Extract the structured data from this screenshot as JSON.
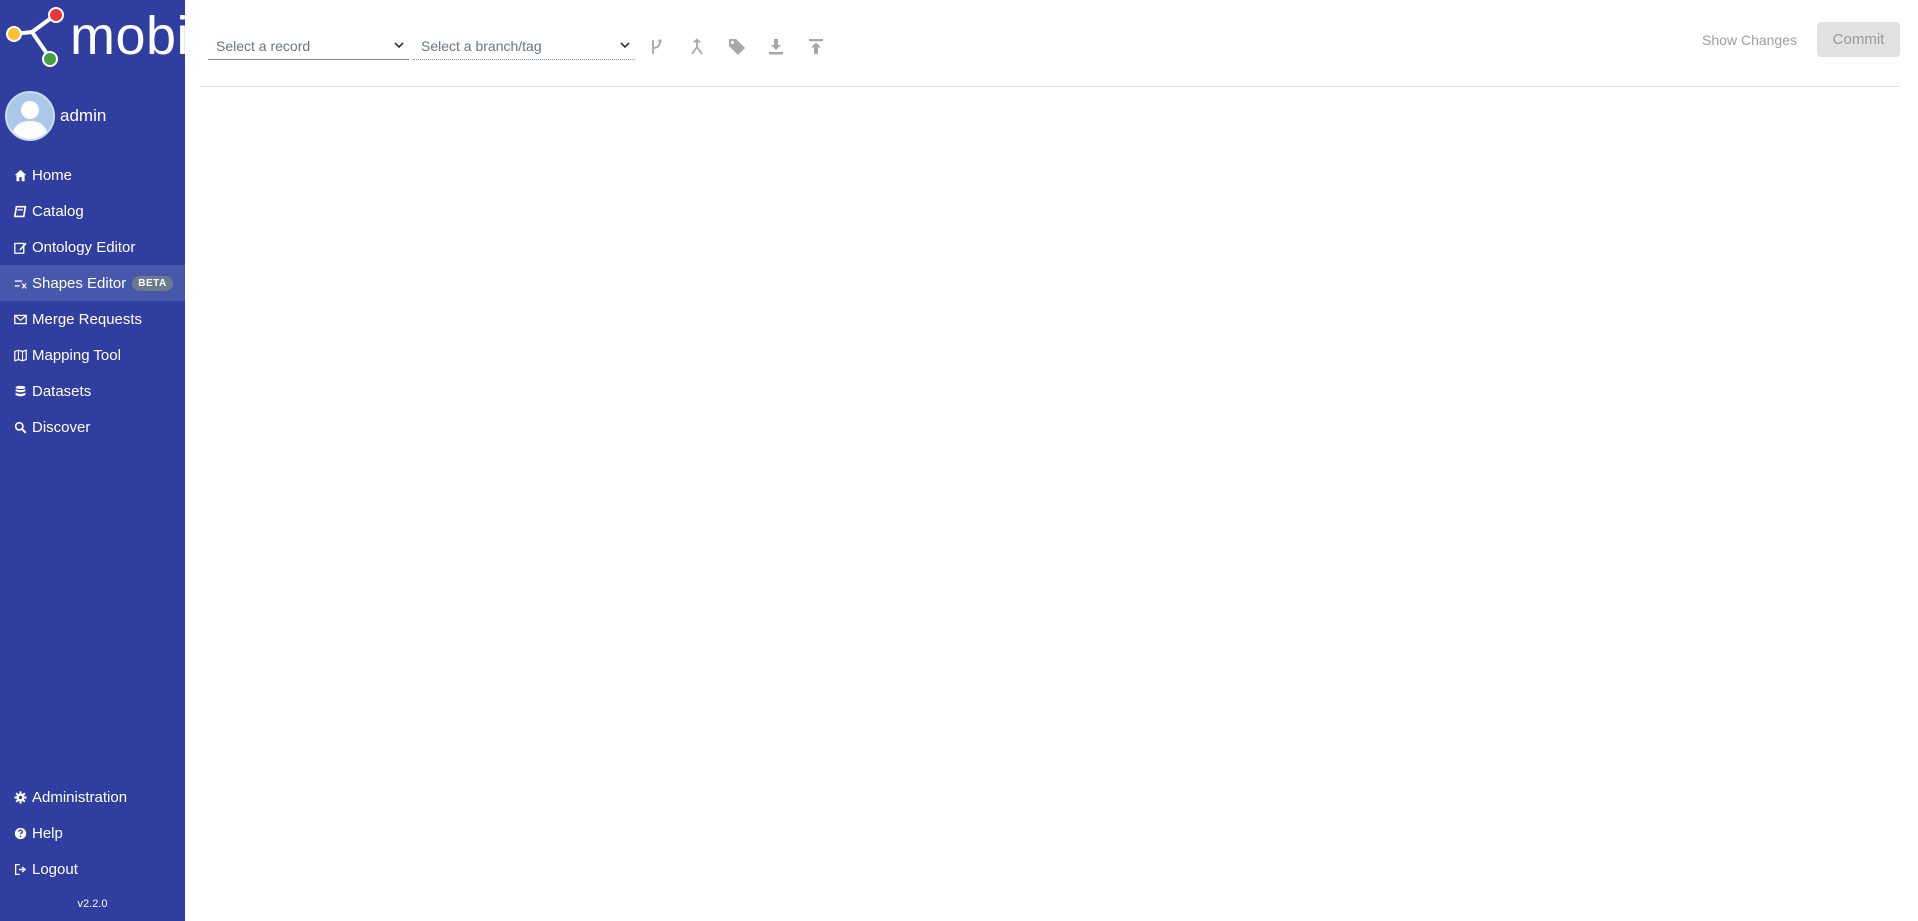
{
  "app": {
    "logo_text": "mobi",
    "version": "v2.2.0"
  },
  "user": {
    "name": "admin"
  },
  "sidebar": {
    "items": [
      {
        "label": "Home",
        "icon": "home-icon"
      },
      {
        "label": "Catalog",
        "icon": "book-icon"
      },
      {
        "label": "Ontology Editor",
        "icon": "edit-icon"
      },
      {
        "label": "Shapes Editor",
        "icon": "shapes-icon",
        "badge": "BETA",
        "active": true
      },
      {
        "label": "Merge Requests",
        "icon": "envelope-icon"
      },
      {
        "label": "Mapping Tool",
        "icon": "map-icon"
      },
      {
        "label": "Datasets",
        "icon": "database-icon"
      },
      {
        "label": "Discover",
        "icon": "search-icon"
      }
    ],
    "bottom_items": [
      {
        "label": "Administration",
        "icon": "gear-icon"
      },
      {
        "label": "Help",
        "icon": "question-circle-icon"
      },
      {
        "label": "Logout",
        "icon": "sign-out-icon"
      }
    ]
  },
  "toolbar": {
    "record_placeholder": "Select a record",
    "branch_placeholder": "Select a branch/tag",
    "tools": [
      "branch-icon",
      "merge-icon",
      "tag-icon",
      "download-icon",
      "upload-icon"
    ],
    "show_changes_label": "Show Changes",
    "commit_label": "Commit"
  },
  "colors": {
    "sidebar_bg": "#303f9f",
    "sidebar_active": "#4657ac",
    "logo_red": "#e53935",
    "logo_yellow": "#fbc02d",
    "logo_green": "#43a047"
  }
}
